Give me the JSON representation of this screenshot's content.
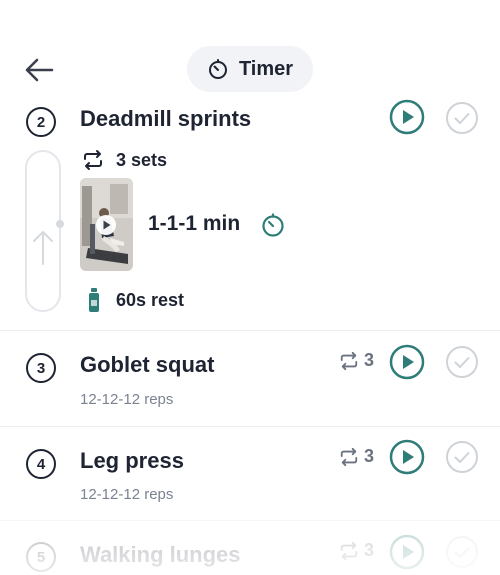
{
  "header": {
    "back_icon": "arrow-left-icon",
    "timer_label": "Timer",
    "timer_icon": "stopwatch-icon"
  },
  "colors": {
    "accent": "#2f7d78",
    "text": "#1f2433",
    "muted": "#7b8290",
    "check": "#cfd3d8"
  },
  "exercises": [
    {
      "number": "2",
      "title": "Deadmill sprints",
      "sets": "3 sets",
      "duration": "1-1-1 min",
      "rest": "60s rest",
      "expanded": true
    },
    {
      "number": "3",
      "title": "Goblet squat",
      "detail": "12-12-12 reps",
      "sets_count": "3"
    },
    {
      "number": "4",
      "title": "Leg press",
      "detail": "12-12-12 reps",
      "sets_count": "3"
    },
    {
      "number": "5",
      "title": "Walking lunges",
      "sets_count": "3"
    }
  ]
}
